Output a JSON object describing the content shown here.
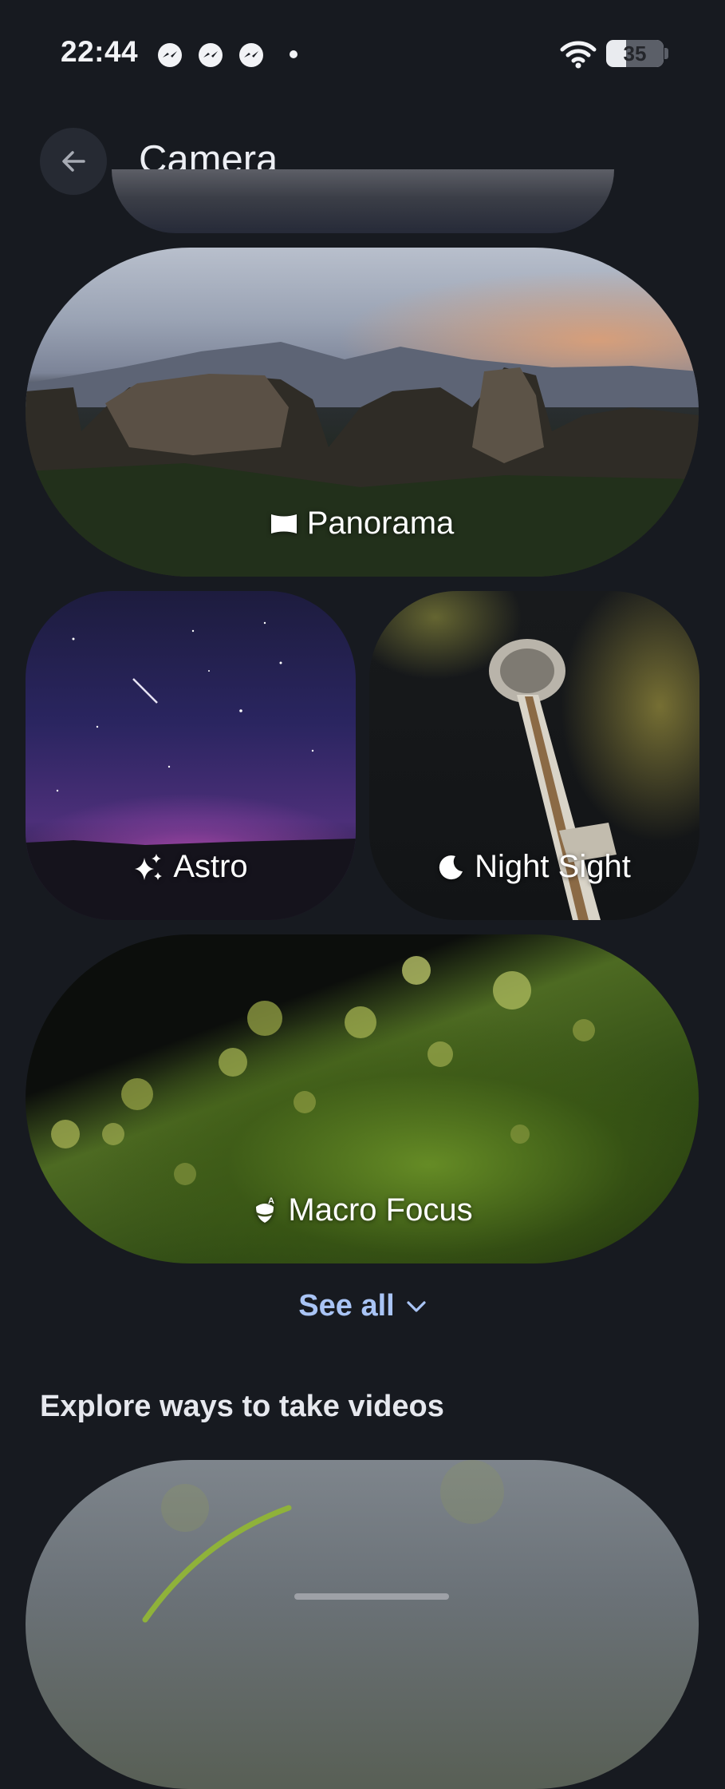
{
  "status_bar": {
    "time": "22:44",
    "notification_icons": [
      "messenger-icon",
      "messenger-icon",
      "messenger-icon"
    ],
    "battery_level": "35",
    "battery_fraction": 0.35
  },
  "header": {
    "title": "Camera",
    "back_icon": "arrow-left-icon"
  },
  "photo_modes": [
    {
      "label": "Panorama",
      "icon": "panorama-icon"
    },
    {
      "label": "Astro",
      "icon": "sparkle-icon"
    },
    {
      "label": "Night Sight",
      "icon": "moon-icon"
    },
    {
      "label": "Macro Focus",
      "icon": "macro-flower-icon"
    }
  ],
  "see_all": {
    "label": "See all",
    "icon": "chevron-down-icon"
  },
  "videos_section": {
    "heading": "Explore ways to take videos"
  },
  "colors": {
    "background": "#171a20",
    "accent_link": "#a9c4f5",
    "text": "#e6e8ee"
  }
}
